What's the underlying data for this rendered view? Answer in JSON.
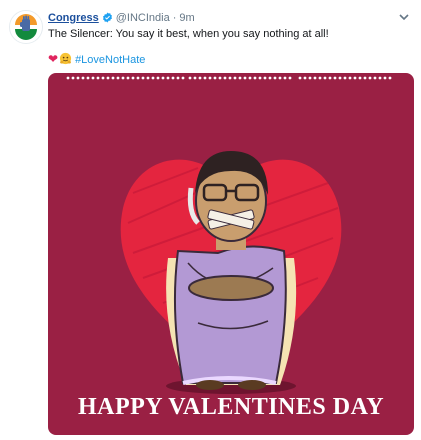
{
  "tweet": {
    "account_name": "Congress",
    "handle": "@INCIndia",
    "separator": "·",
    "time": "9m",
    "text": "The Silencer: You say it best, when you say nothing at all!",
    "hashtag": "#LoveNotHate"
  },
  "media": {
    "caption": "Happy Valentines Day",
    "background_color": "#9a2044",
    "heart_color": "#e4253f"
  },
  "colors": {
    "name": "#1b4f9c",
    "link": "#1b95e0",
    "muted": "#657786",
    "verified": "#1da1f2"
  },
  "icons": [
    "congress-logo-avatar",
    "verified-badge-icon",
    "chevron-down-icon",
    "red-heart-emoji",
    "hugging-face-emoji"
  ]
}
